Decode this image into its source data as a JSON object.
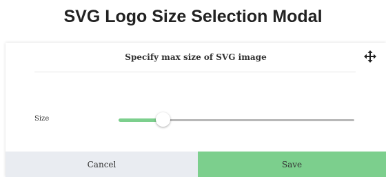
{
  "page": {
    "title": "SVG Logo Size Selection Modal"
  },
  "modal": {
    "title": "Specify max size of SVG image",
    "move_icon": "move-icon",
    "size_label": "Size",
    "slider": {
      "fraction": 0.19,
      "fill_color": "#7ccf8d",
      "track_color": "#b8b8b8"
    },
    "buttons": {
      "cancel_label": "Cancel",
      "save_label": "Save"
    }
  },
  "colors": {
    "accent": "#7ccf8d",
    "cancel_bg": "#e9ecf1"
  }
}
